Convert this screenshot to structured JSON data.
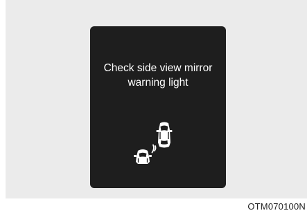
{
  "warning": {
    "line1": "Check side view mirror",
    "line2": "warning light"
  },
  "icon": "blind-spot-warning-icon",
  "figure_code": "OTM070100N",
  "colors": {
    "display_background": "#1e1e1e",
    "panel_background": "#ebebeb",
    "text": "#ffffff"
  }
}
